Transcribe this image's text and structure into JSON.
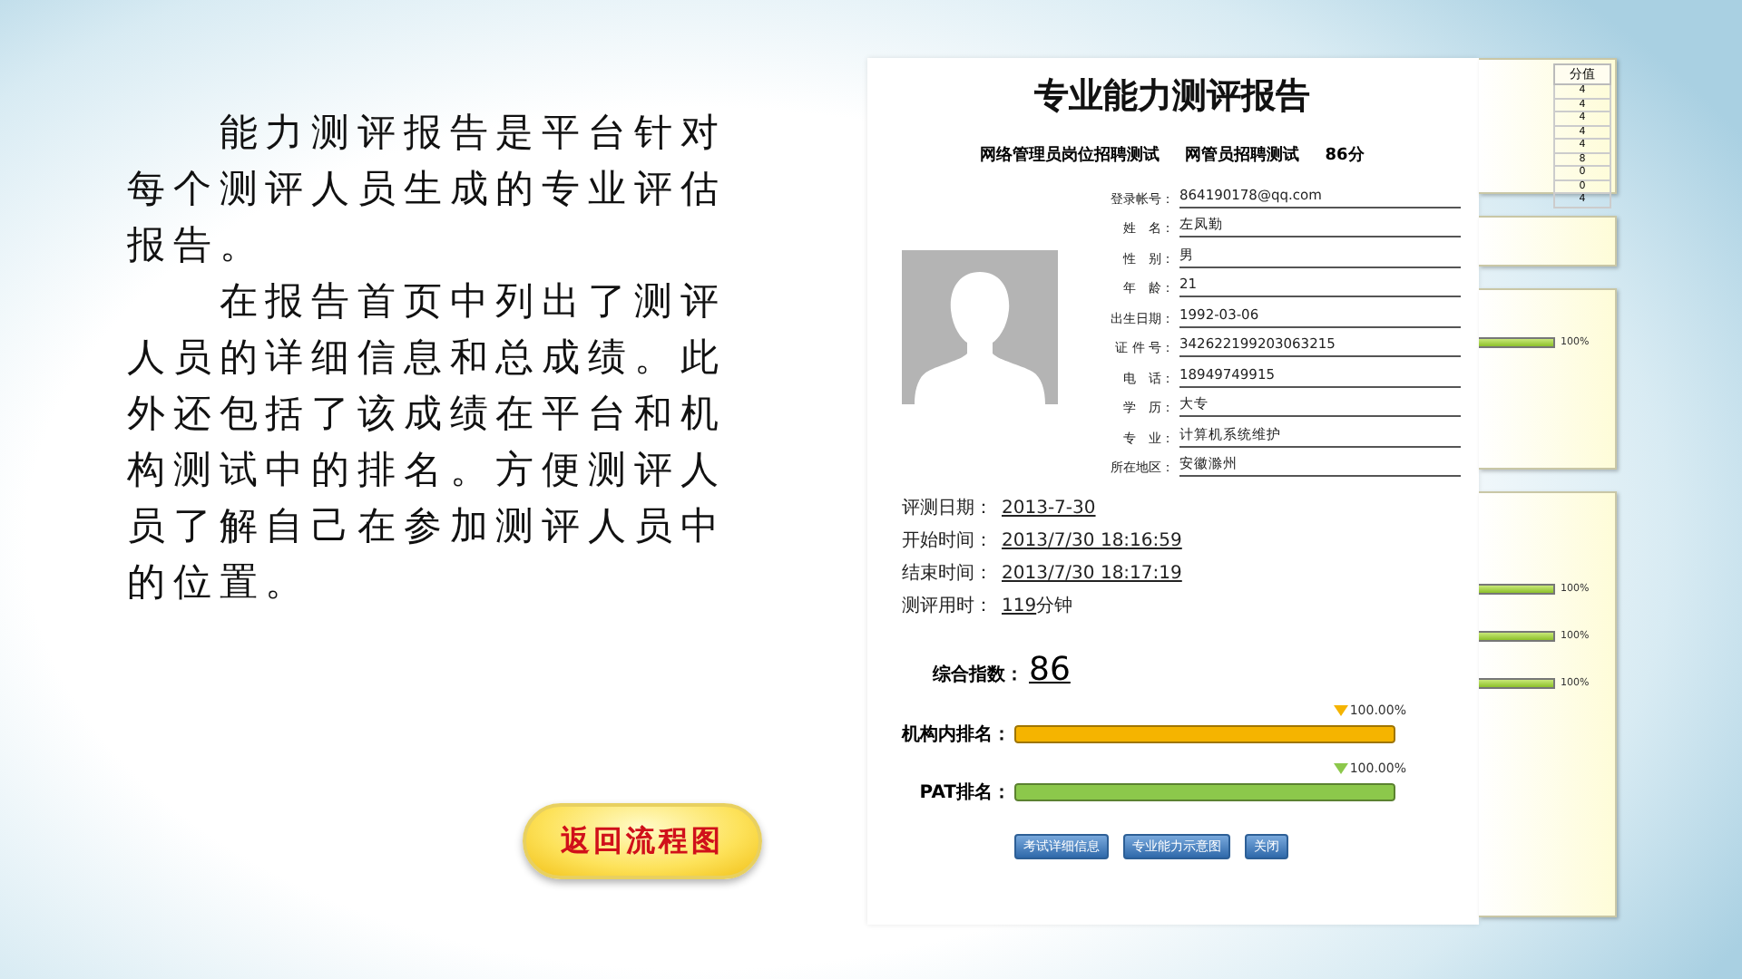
{
  "slide": {
    "paragraphs": [
      "能力测评报告是平台针对每个测评人员生成的专业评估报告。",
      "在报告首页中列出了测评人员的详细信息和总成绩。此外还包括了该成绩在平台和机构测试中的排名。方便测评人员了解自己在参加测评人员中的位置。"
    ],
    "back_button": "返回流程图"
  },
  "report": {
    "title": "专业能力测评报告",
    "subtitle": [
      "网络管理员岗位招聘测试",
      "网管员招聘测试",
      "86分"
    ],
    "fields": [
      {
        "label": "登录帐号：",
        "value": "864190178@qq.com"
      },
      {
        "label": "姓　名：",
        "value": "左凤勤"
      },
      {
        "label": "性　别：",
        "value": "男"
      },
      {
        "label": "年　龄：",
        "value": "21"
      },
      {
        "label": "出生日期：",
        "value": "1992-03-06"
      },
      {
        "label": "证 件 号：",
        "value": "342622199203063215"
      },
      {
        "label": "电　话：",
        "value": "18949749915"
      },
      {
        "label": "学　历：",
        "value": "大专"
      },
      {
        "label": "专　业：",
        "value": "计算机系统维护"
      },
      {
        "label": "所在地区：",
        "value": "安徽滁州"
      }
    ],
    "times": [
      {
        "label": "评测日期：",
        "value": "2013-7-30"
      },
      {
        "label": "开始时间：",
        "value": "2013/7/30 18:16:59"
      },
      {
        "label": "结束时间：",
        "value": "2013/7/30 18:17:19"
      },
      {
        "label": "测评用时：",
        "value": "119",
        "unit": "分钟"
      }
    ],
    "index": {
      "label": "综合指数：",
      "value": "86"
    },
    "rankings": [
      {
        "label": "机构内排名：",
        "level": 1,
        "reading": "100.00%",
        "color": "#f5b400"
      },
      {
        "label": "PAT排名：",
        "level": 1,
        "reading": "100.00%",
        "color": "#8cc84b"
      }
    ],
    "buttons": [
      "考试详细信息",
      "专业能力示意图",
      "关闭"
    ]
  },
  "side_panel": {
    "header": "分值",
    "scores": [
      "4",
      "4",
      "4",
      "4",
      "4",
      "8",
      "0",
      "0",
      "4"
    ],
    "panels": [
      {
        "kind": "blank"
      },
      {
        "kind": "bars",
        "bars": [
          {
            "reading": "100%"
          }
        ]
      },
      {
        "kind": "bars",
        "bars": [
          {
            "reading": "100%"
          },
          {
            "reading": "100%"
          },
          {
            "reading": "100%"
          }
        ]
      }
    ]
  }
}
